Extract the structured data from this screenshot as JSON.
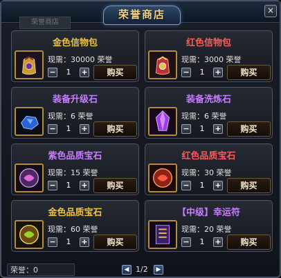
{
  "window": {
    "title": "荣誉商店",
    "faded_tab": "荣誉商店",
    "close_label": "×"
  },
  "items": [
    {
      "name": "金色信物包",
      "price": "现需：30000 荣誉",
      "qty": "1",
      "buy": "购买",
      "name_color": "#f0c040",
      "icon": "gold-token-pack-icon"
    },
    {
      "name": "红色信物包",
      "price": "现需：3000 荣誉",
      "qty": "1",
      "buy": "购买",
      "name_color": "#ff5a5a",
      "icon": "red-token-pack-icon"
    },
    {
      "name": "装备升级石",
      "price": "现需：6 荣誉",
      "qty": "1",
      "buy": "购买",
      "name_color": "#c77dff",
      "icon": "blue-upgrade-stone-icon"
    },
    {
      "name": "装备洗炼石",
      "price": "现需：6 荣誉",
      "qty": "1",
      "buy": "购买",
      "name_color": "#c77dff",
      "icon": "purple-refine-crystal-icon"
    },
    {
      "name": "紫色品质宝石",
      "price": "现需：15 荣誉",
      "qty": "1",
      "buy": "购买",
      "name_color": "#c77dff",
      "icon": "purple-gem-icon"
    },
    {
      "name": "红色品质宝石",
      "price": "现需：30 荣誉",
      "qty": "1",
      "buy": "购买",
      "name_color": "#ff5a5a",
      "icon": "red-gem-icon"
    },
    {
      "name": "金色品质宝石",
      "price": "现需：60 荣誉",
      "qty": "1",
      "buy": "购买",
      "name_color": "#f0c040",
      "icon": "gold-gem-icon"
    },
    {
      "name": "【中级】幸运符",
      "price": "现需：20 荣誉",
      "qty": "1",
      "buy": "购买",
      "name_color": "#c77dff",
      "icon": "luck-charm-icon"
    }
  ],
  "controls": {
    "minus": "−",
    "plus": "+"
  },
  "footer": {
    "honor_label": "荣誉：0",
    "page": "1/2",
    "prev": "◀",
    "next": "▶"
  }
}
